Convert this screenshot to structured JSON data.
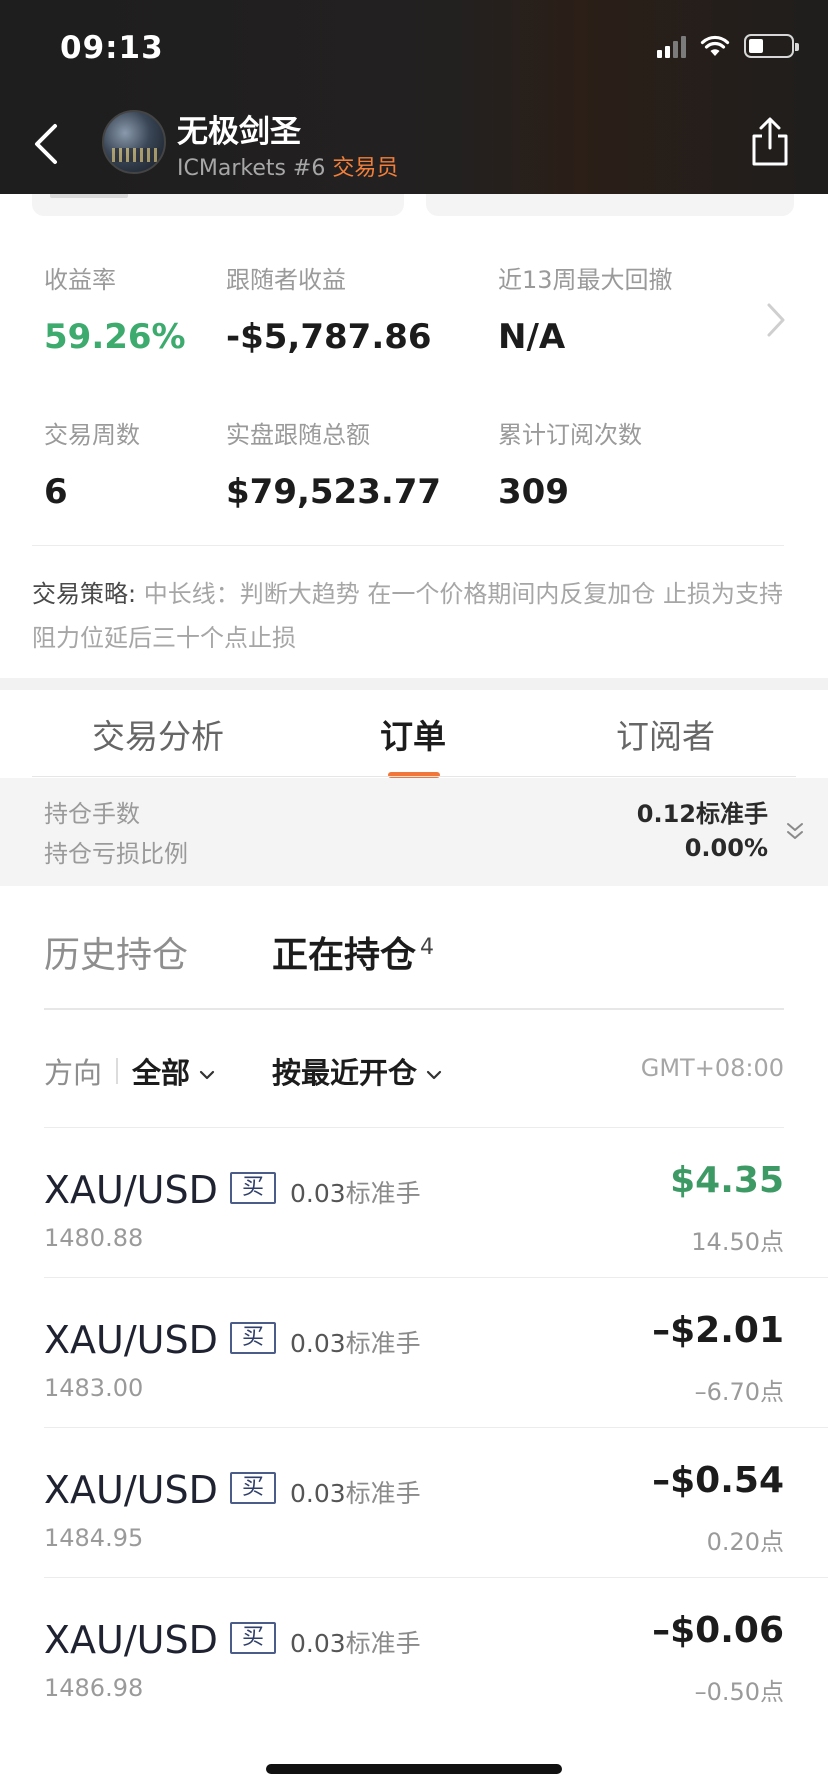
{
  "status_bar": {
    "time": "09:13"
  },
  "header": {
    "name": "无极剑圣",
    "broker": "ICMarkets #6",
    "role": "交易员"
  },
  "stats": [
    {
      "label": "收益率",
      "value": "59.26%"
    },
    {
      "label": "跟随者收益",
      "value": "-$5,787.86"
    },
    {
      "label": "近13周最大回撤",
      "value": "N/A"
    },
    {
      "label": "交易周数",
      "value": "6"
    },
    {
      "label": "实盘跟随总额",
      "value": "$79,523.77"
    },
    {
      "label": "累计订阅次数",
      "value": "309"
    }
  ],
  "strategy": {
    "label": "交易策略:",
    "text": "中长线：判断大趋势 在一个价格期间内反复加仓 止损为支持阻力位延后三十个点止损"
  },
  "tabs": [
    {
      "label": "交易分析"
    },
    {
      "label": "订单"
    },
    {
      "label": "订阅者"
    }
  ],
  "summary": {
    "lots_label": "持仓手数",
    "lots_value": "0.12标准手",
    "loss_ratio_label": "持仓亏损比例",
    "loss_ratio_value": "0.00%"
  },
  "position_tabs": {
    "history": "历史持仓",
    "open": "正在持仓",
    "open_count": "4"
  },
  "filters": {
    "direction_label": "方向",
    "direction_value": "全部",
    "sort_value": "按最近开仓",
    "timezone": "GMT+08:00"
  },
  "positions": [
    {
      "symbol": "XAU/USD",
      "side": "买",
      "lot_num": "0.03",
      "lot_unit": "标准手",
      "open_price": "1480.88",
      "pnl": "$4.35",
      "points": "14.50点"
    },
    {
      "symbol": "XAU/USD",
      "side": "买",
      "lot_num": "0.03",
      "lot_unit": "标准手",
      "open_price": "1483.00",
      "pnl": "–$2.01",
      "points": "–6.70点"
    },
    {
      "symbol": "XAU/USD",
      "side": "买",
      "lot_num": "0.03",
      "lot_unit": "标准手",
      "open_price": "1484.95",
      "pnl": "–$0.54",
      "points": "0.20点"
    },
    {
      "symbol": "XAU/USD",
      "side": "买",
      "lot_num": "0.03",
      "lot_unit": "标准手",
      "open_price": "1486.98",
      "pnl": "–$0.06",
      "points": "–0.50点"
    }
  ],
  "colors": {
    "accent": "#f0763a",
    "positive": "#3daa6e",
    "header_bg": "#1f1e1d",
    "role": "#f07f3c"
  }
}
